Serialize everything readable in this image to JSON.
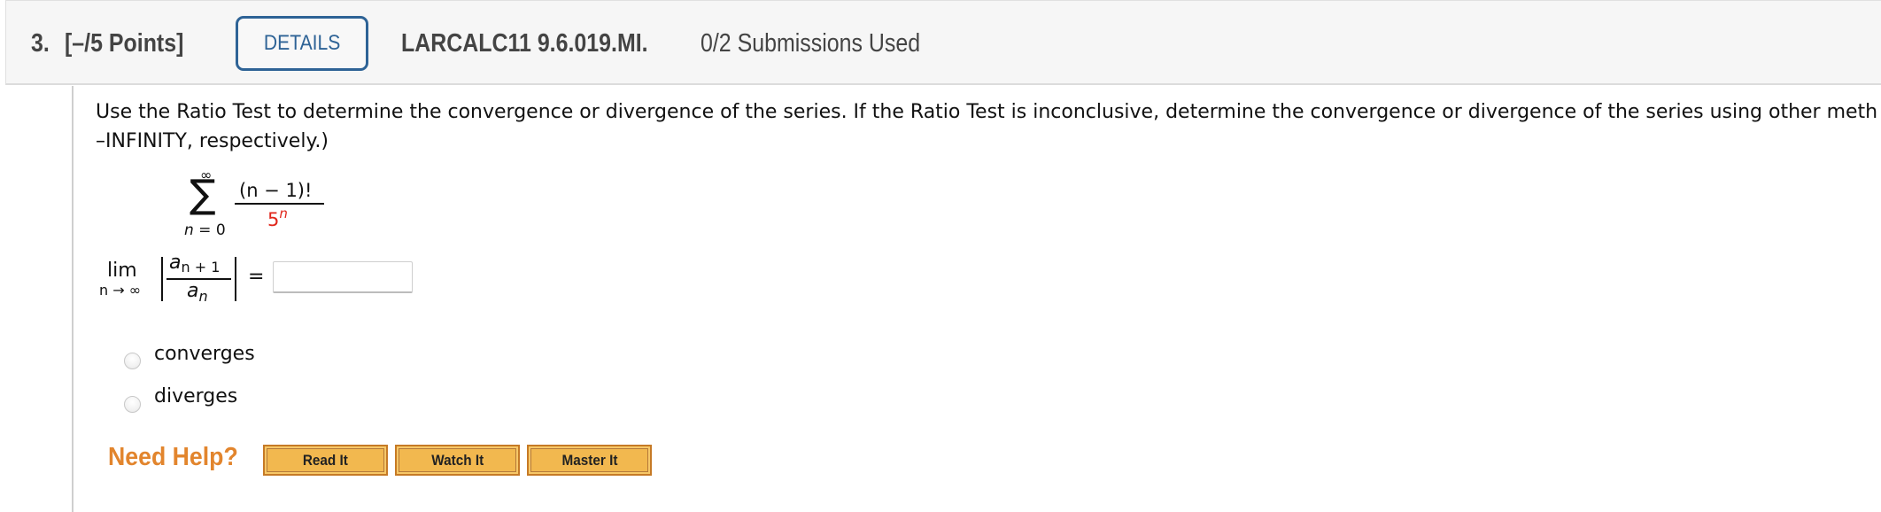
{
  "header": {
    "question_number": "3.",
    "points": "[–/5 Points]",
    "details_label": "DETAILS",
    "problem_code": "LARCALC11 9.6.019.MI.",
    "submissions": "0/2 Submissions Used"
  },
  "question": {
    "line1": "Use the Ratio Test to determine the convergence or divergence of the series. If the Ratio Test is inconclusive, determine the convergence or divergence of the series using other meth",
    "line2": "–INFINITY, respectively.)",
    "series": {
      "sum_symbol": "∑",
      "upper_limit": "∞",
      "lower_limit_var": "n",
      "lower_limit_rest": " = 0",
      "numerator": "(n − 1)!",
      "denominator_base": "5",
      "denominator_exp": "n",
      "highlight_color": "#e0261b"
    },
    "limit": {
      "lim_label": "lim",
      "lim_sub": "n → ∞",
      "ratio_num_base": "a",
      "ratio_num_sub": "n + 1",
      "ratio_den_base": "a",
      "ratio_den_sub": "n",
      "equals": "=",
      "answer_value": ""
    },
    "options": [
      {
        "label": "converges",
        "selected": false
      },
      {
        "label": "diverges",
        "selected": false
      }
    ]
  },
  "help": {
    "need_help_label": "Need Help?",
    "buttons": [
      "Read It",
      "Watch It",
      "Master It"
    ]
  },
  "colors": {
    "details_accent": "#2e6396",
    "need_help": "#e2852d",
    "help_button_fill": "#f2b84f"
  }
}
